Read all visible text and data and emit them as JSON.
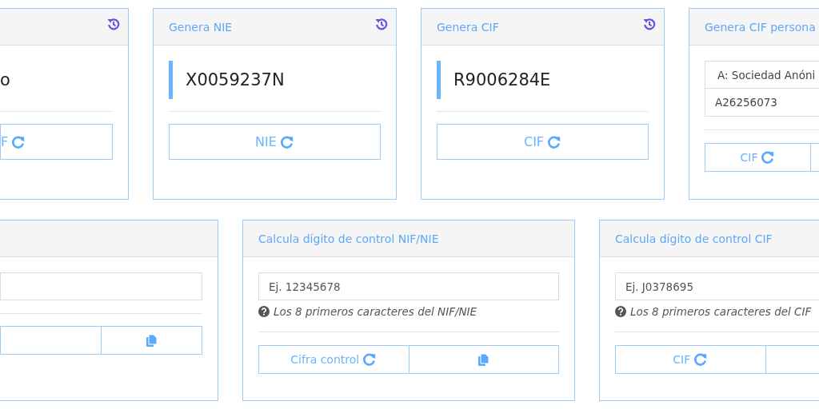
{
  "generators": [
    {
      "kind": "value",
      "value": "o",
      "buttons": [
        {
          "kind": "generate",
          "label": "F"
        }
      ]
    },
    {
      "kind": "value",
      "title": "Genera NIE",
      "value": "X0059237N",
      "buttons": [
        {
          "kind": "generate",
          "label": "NIE"
        }
      ]
    },
    {
      "kind": "value",
      "title": "Genera CIF",
      "value": "R9006284E",
      "buttons": [
        {
          "kind": "generate",
          "label": "CIF"
        }
      ]
    },
    {
      "kind": "form",
      "title": "Genera CIF persona",
      "select": "A: Sociedad Anóni",
      "value": "A26256073",
      "buttons": [
        {
          "kind": "generate",
          "label": "CIF"
        },
        {
          "kind": "empty"
        }
      ]
    }
  ],
  "calculators": [
    {
      "buttons": [
        {
          "kind": "empty"
        },
        {
          "kind": "copy"
        }
      ]
    },
    {
      "title": "Calcula dígito de control NIF/NIE",
      "placeholder": "Ej. 12345678",
      "hint": "Los 8 primeros caracteres del NIF/NIE",
      "buttons": [
        {
          "kind": "generate",
          "label": "Cifra control"
        },
        {
          "kind": "copy"
        }
      ]
    },
    {
      "title": "Calcula dígito de control CIF",
      "placeholder": "Ej. J0378695",
      "hint": "Los 8 primeros caracteres del CIF",
      "buttons": [
        {
          "kind": "generate",
          "label": "CIF"
        },
        {
          "kind": "empty"
        }
      ]
    }
  ]
}
